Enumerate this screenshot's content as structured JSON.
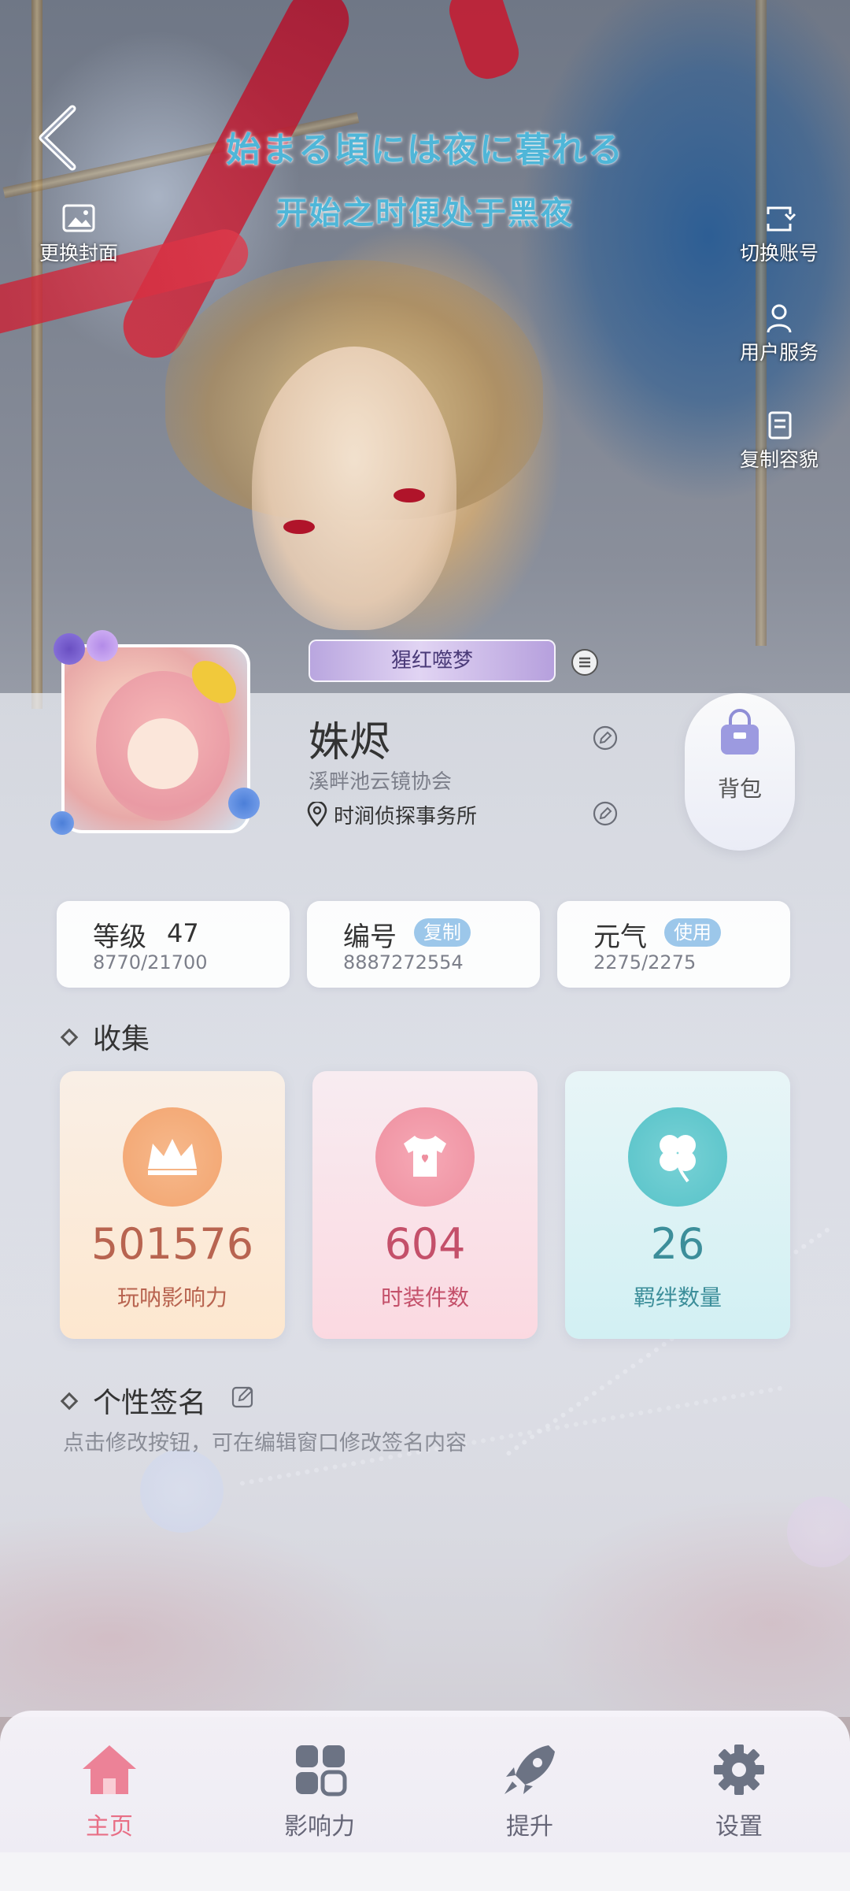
{
  "header": {
    "title_jp": "始まる頃には夜に暮れる",
    "title_cn": "开始之时便处于黑夜"
  },
  "side_actions": {
    "change_cover": "更换封面",
    "switch_account": "切换账号",
    "user_service": "用户服务",
    "copy_appearance": "复制容貌"
  },
  "profile": {
    "badge_title": "猩红噬梦",
    "name": "姝烬",
    "guild": "溪畔池云镜协会",
    "location": "时涧侦探事务所",
    "bag_label": "背包"
  },
  "stats": {
    "level": {
      "label": "等级",
      "value": "47",
      "progress": "8770/21700"
    },
    "id": {
      "label": "编号",
      "chip": "复制",
      "value": "8887272554"
    },
    "energy": {
      "label": "元气",
      "chip": "使用",
      "value": "2275/2275"
    }
  },
  "collection": {
    "title": "收集",
    "items": [
      {
        "value": "501576",
        "label": "玩呐影响力",
        "icon": "crown-icon"
      },
      {
        "value": "604",
        "label": "时装件数",
        "icon": "tshirt-icon"
      },
      {
        "value": "26",
        "label": "羁绊数量",
        "icon": "clover-icon"
      }
    ]
  },
  "signature": {
    "title": "个性签名",
    "hint": "点击修改按钮，可在编辑窗口修改签名内容"
  },
  "nav": {
    "items": [
      {
        "label": "主页",
        "icon": "home-icon",
        "active": true
      },
      {
        "label": "影响力",
        "icon": "grid-icon",
        "active": false
      },
      {
        "label": "提升",
        "icon": "rocket-icon",
        "active": false
      },
      {
        "label": "设置",
        "icon": "gear-icon",
        "active": false
      }
    ]
  },
  "colors": {
    "accent_pink": "#e86f86",
    "chip_blue": "#9cc7ea",
    "title_cyan": "#4fb6d8"
  }
}
